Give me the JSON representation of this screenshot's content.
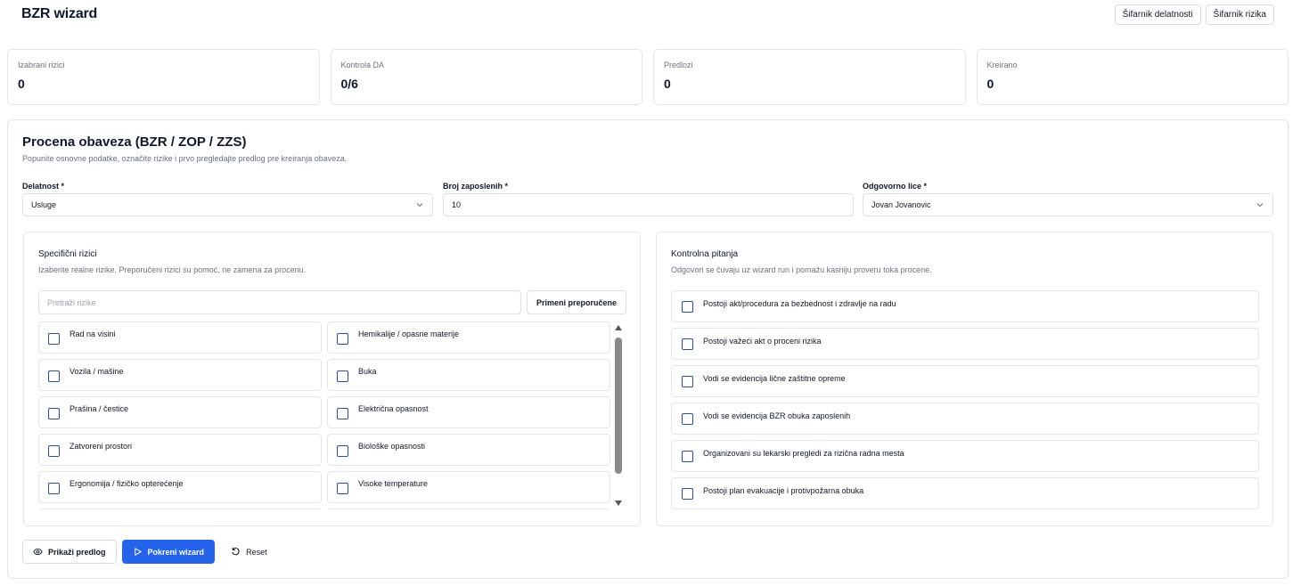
{
  "app": {
    "title": "BZR wizard"
  },
  "top_buttons": {
    "activity_codebook": "Šifarnik delatnosti",
    "risk_codebook": "Šifarnik rizika"
  },
  "stats": [
    {
      "label": "Izabrani rizici",
      "value": "0"
    },
    {
      "label": "Kontrola DA",
      "value": "0/6"
    },
    {
      "label": "Predlozi",
      "value": "0"
    },
    {
      "label": "Kreirano",
      "value": "0"
    }
  ],
  "form": {
    "title": "Procena obaveza (BZR / ZOP / ZZS)",
    "subtitle": "Popunite osnovne podatke, označite rizike i prvo pregledajte predlog pre kreiranja obaveza.",
    "activity": {
      "label": "Delatnost *",
      "value": "Usluge"
    },
    "employees": {
      "label": "Broj zaposlenih *",
      "value": "10"
    },
    "responsible": {
      "label": "Odgovorno lice *",
      "value": "Jovan Jovanovic"
    }
  },
  "risks": {
    "title": "Specifični rizici",
    "subtitle": "Izaberite realne rizike. Preporučeni rizici su pomoć, ne zamena za procenu.",
    "search_placeholder": "Pretraži rizike",
    "apply_label": "Primeni preporučene",
    "items": [
      "Rad na visini",
      "Hemikalije / opasne materije",
      "Vozila / mašine",
      "Buka",
      "Prašina / čestice",
      "Električna opasnost",
      "Zatvoreni prostori",
      "Biološke opasnosti",
      "Ergonomija / fizičko opterećenje",
      "Visoke temperature"
    ]
  },
  "questions": {
    "title": "Kontrolna pitanja",
    "subtitle": "Odgovori se čuvaju uz wizard run i pomažu kasniju proveru toka procene.",
    "items": [
      "Postoji akt/procedura za bezbednost i zdravlje na radu",
      "Postoji važeći akt o proceni rizika",
      "Vodi se evidencija lične zaštitne opreme",
      "Vodi se evidencija BZR obuka zaposlenih",
      "Organizovani su lekarski pregledi za rizična radna mesta",
      "Postoji plan evakuacije i protivpožarna obuka"
    ]
  },
  "actions": {
    "preview": "Prikaži predlog",
    "run": "Pokreni wizard",
    "reset": "Reset"
  },
  "colors": {
    "primary": "#2563eb",
    "checkbox_border": "#2f4e8f",
    "border": "#e2e5ea",
    "muted_text": "#6b7280"
  },
  "icons": {
    "preview": "eye-icon",
    "run": "play-icon",
    "reset": "rotate-ccw-icon",
    "select": "chevron-down-icon"
  }
}
